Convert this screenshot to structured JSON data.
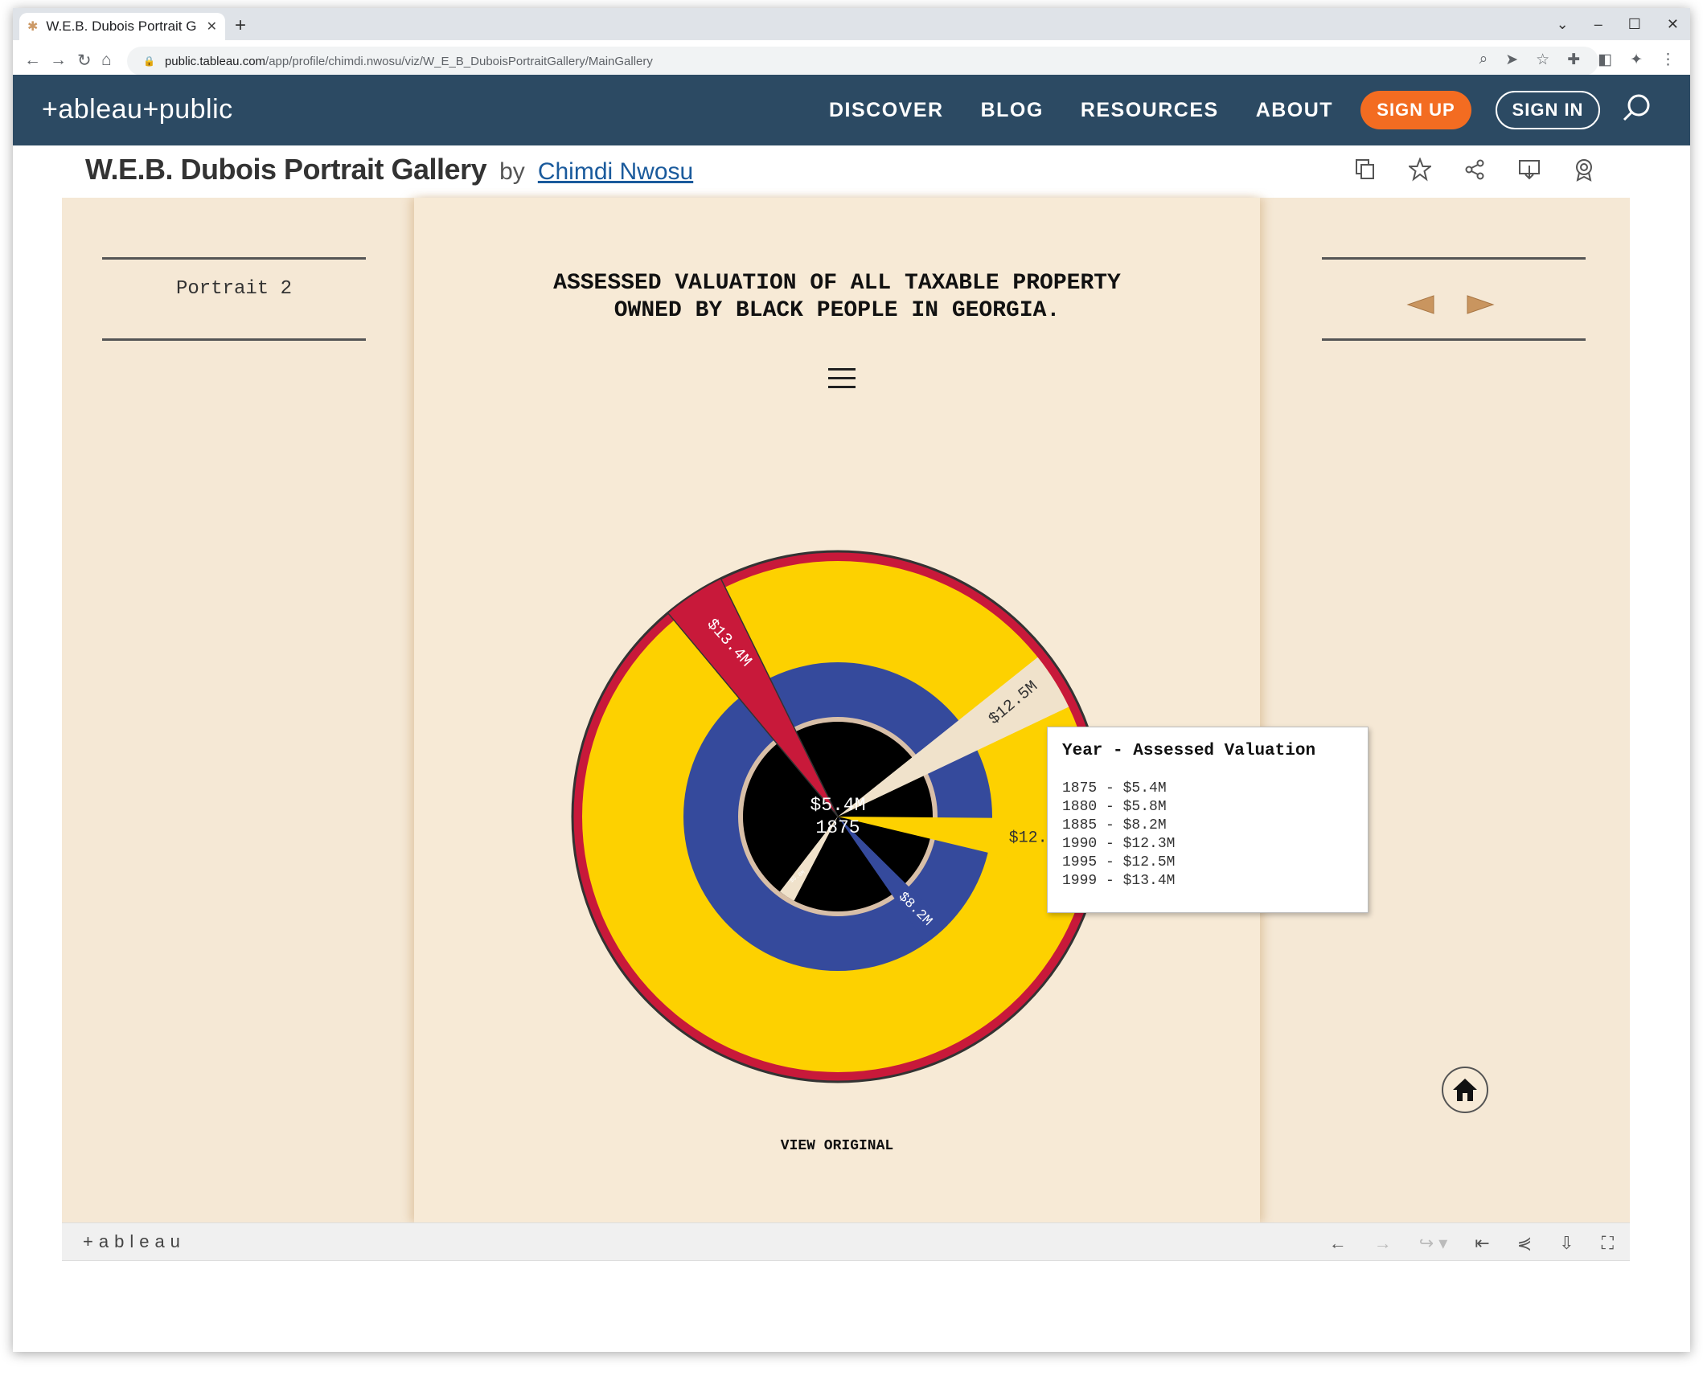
{
  "browser": {
    "tab_title": "W.E.B. Dubois Portrait G",
    "url_host": "public.tableau.com",
    "url_path": "/app/profile/chimdi.nwosu/viz/W_E_B_DuboisPortraitGallery/MainGallery"
  },
  "header": {
    "logo": "+ableau+public",
    "nav": [
      "DISCOVER",
      "BLOG",
      "RESOURCES",
      "ABOUT"
    ],
    "signup_label": "SIGN UP",
    "signin_label": "SIGN IN"
  },
  "viz": {
    "title": "W.E.B. Dubois Portrait Gallery",
    "by": "by",
    "author": "Chimdi Nwosu"
  },
  "dashboard": {
    "portrait_label": "Portrait 2",
    "chart_title": "ASSESSED VALUATION OF ALL TAXABLE PROPERTY\nOWNED BY BLACK PEOPLE IN GEORGIA.",
    "view_original": "VIEW ORIGINAL",
    "center_value": "$5.4M",
    "center_year": "1875",
    "colors": {
      "background": "#f5e8d5",
      "red": "#c8193a",
      "yellow": "#fdd100",
      "blue": "#354a9c",
      "black": "#000000",
      "tan": "#f0e2cb"
    }
  },
  "chart_data": {
    "type": "radial-bar",
    "title": "ASSESSED VALUATION OF ALL TAXABLE PROPERTY OWNED BY BLACK PEOPLE IN GEORGIA.",
    "categories": [
      "1875",
      "1880",
      "1885",
      "1990",
      "1995",
      "1999"
    ],
    "values": [
      5.4,
      5.8,
      8.2,
      12.3,
      12.5,
      13.4
    ],
    "labels": [
      "$5.4M",
      "$5.8M",
      "$8.2M",
      "$12.3M",
      "$12.5M",
      "$13.4M"
    ],
    "unit": "Millions of dollars"
  },
  "tooltip": {
    "header": "Year - Assessed Valuation",
    "rows": [
      "1875 - $5.4M",
      "1880 - $5.8M",
      "1885 - $8.2M",
      "1990 - $12.3M",
      "1995 - $12.5M",
      "1999 - $13.4M"
    ]
  },
  "footer": {
    "brand": "+ableau"
  }
}
